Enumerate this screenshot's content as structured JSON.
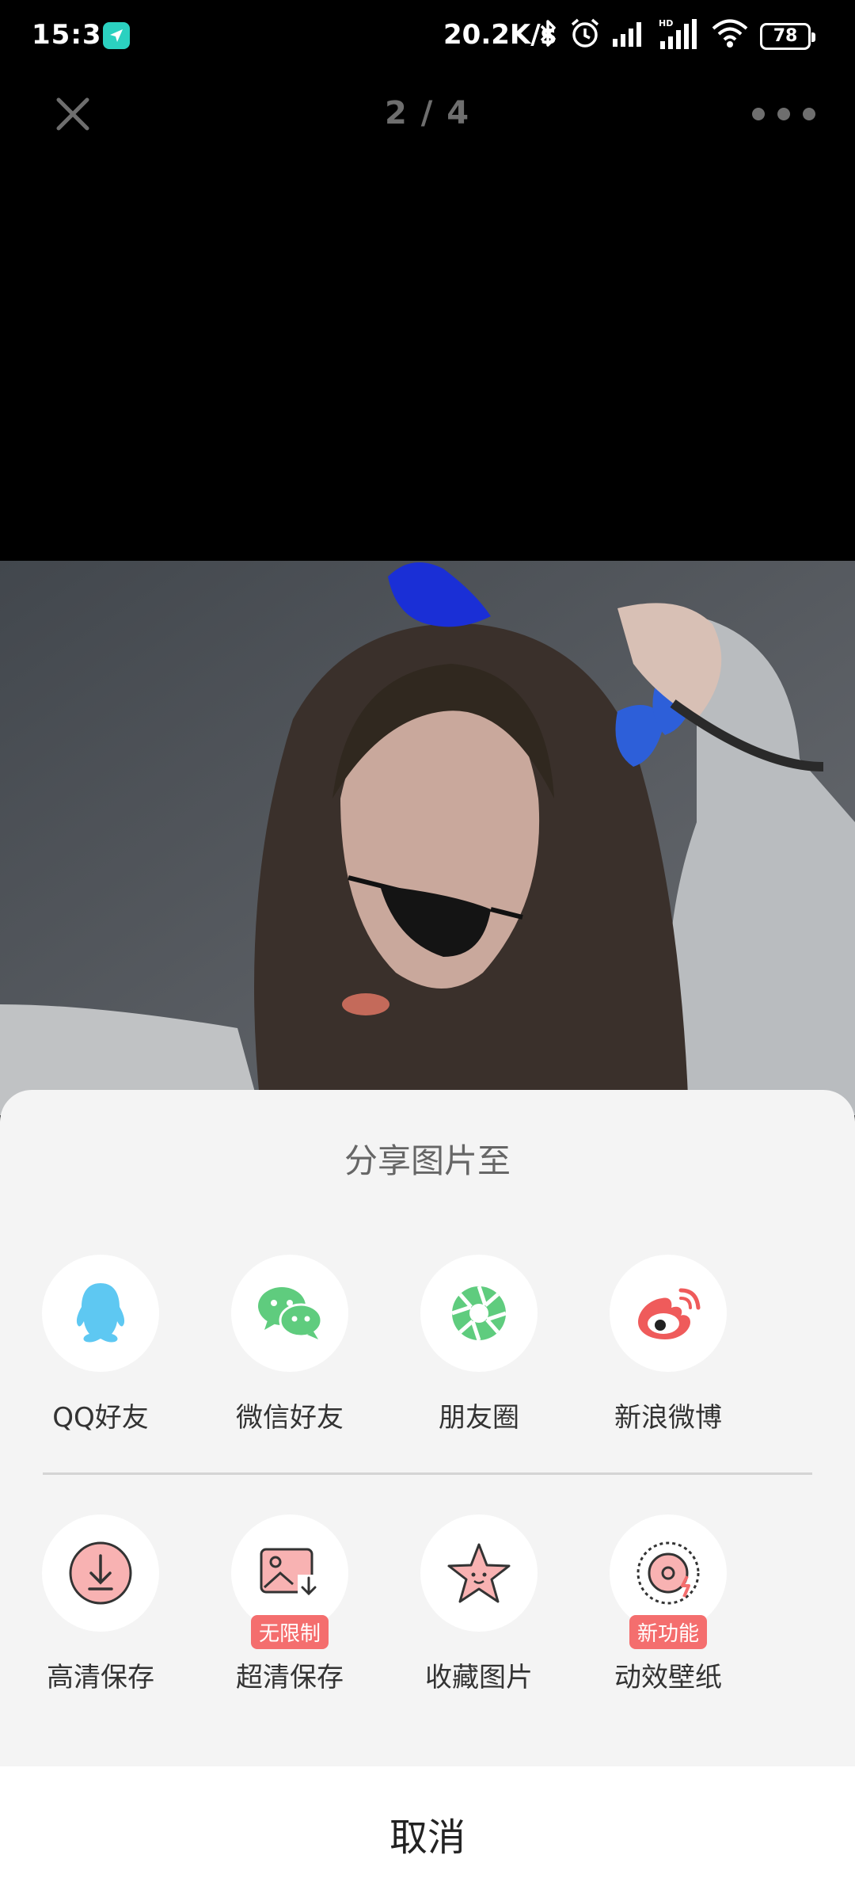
{
  "status": {
    "time": "15:31",
    "speed": "20.2K/s",
    "battery": "78",
    "icons": [
      "location-arrow-icon",
      "bluetooth-icon",
      "alarm-icon",
      "signal-icon",
      "hd-signal-icon",
      "wifi-icon",
      "battery-icon"
    ]
  },
  "viewer": {
    "page_indicator": "2 / 4"
  },
  "share": {
    "title": "分享图片至",
    "row1": [
      {
        "label": "QQ好友",
        "icon": "qq-penguin-icon",
        "color": "#5ec8f2"
      },
      {
        "label": "微信好友",
        "icon": "wechat-icon",
        "color": "#5fcc7e"
      },
      {
        "label": "朋友圈",
        "icon": "moments-aperture-icon",
        "color": "#5fcc7e"
      },
      {
        "label": "新浪微博",
        "icon": "weibo-icon",
        "color": "#ef5b5b"
      }
    ],
    "row2": [
      {
        "label": "高清保存",
        "icon": "download-icon"
      },
      {
        "label": "超清保存",
        "icon": "image-download-icon",
        "badge": "无限制"
      },
      {
        "label": "收藏图片",
        "icon": "star-face-icon"
      },
      {
        "label": "动效壁纸",
        "icon": "live-wallpaper-icon",
        "badge": "新功能"
      }
    ],
    "cancel": "取消"
  },
  "colors": {
    "accent_red": "#f46e6e",
    "sheet_bg": "#f4f4f4"
  }
}
